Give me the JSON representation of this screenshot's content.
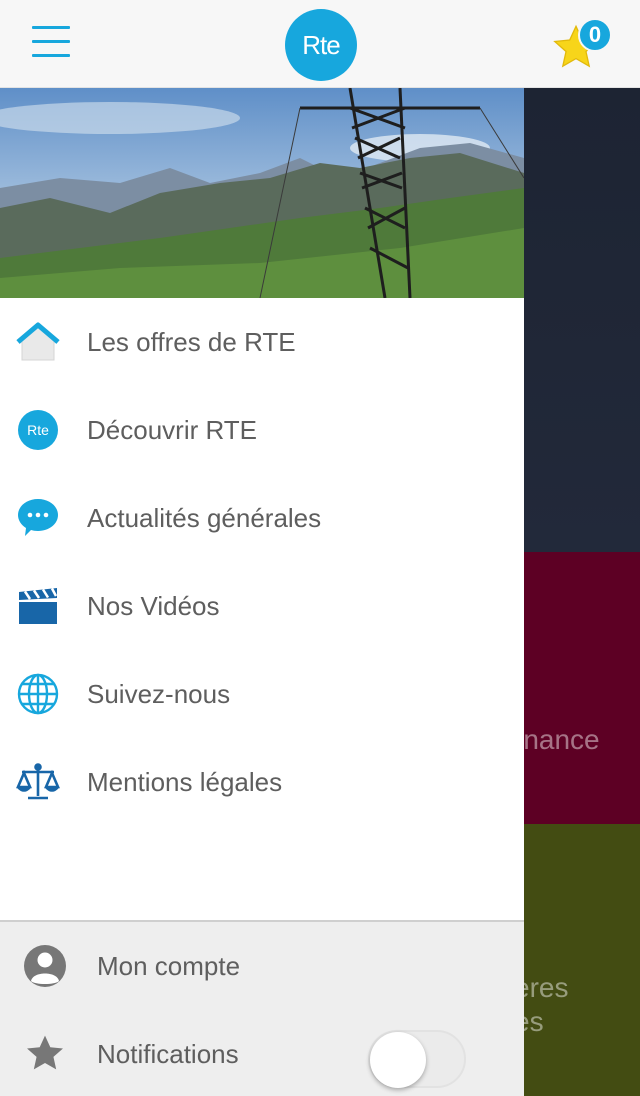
{
  "header": {
    "logo_text": "Rte",
    "favorites_count": "0",
    "accent_color": "#17a7dd",
    "star_color": "#f7d51a"
  },
  "background": {
    "card_red_text": "rnance",
    "card_olive_text_1": "ères",
    "card_olive_text_2": "es"
  },
  "menu": {
    "items": [
      {
        "label": "Les offres de RTE",
        "icon": "home-icon"
      },
      {
        "label": "Découvrir RTE",
        "icon": "rte-logo-icon"
      },
      {
        "label": "Actualités générales",
        "icon": "chat-bubble-icon"
      },
      {
        "label": "Nos Vidéos",
        "icon": "clapperboard-icon"
      },
      {
        "label": "Suivez-nous",
        "icon": "globe-icon"
      },
      {
        "label": "Mentions légales",
        "icon": "scales-icon"
      }
    ],
    "small_logo_text": "Rte"
  },
  "footer": {
    "account_label": "Mon compte",
    "notifications_label": "Notifications",
    "notifications_enabled": false
  }
}
